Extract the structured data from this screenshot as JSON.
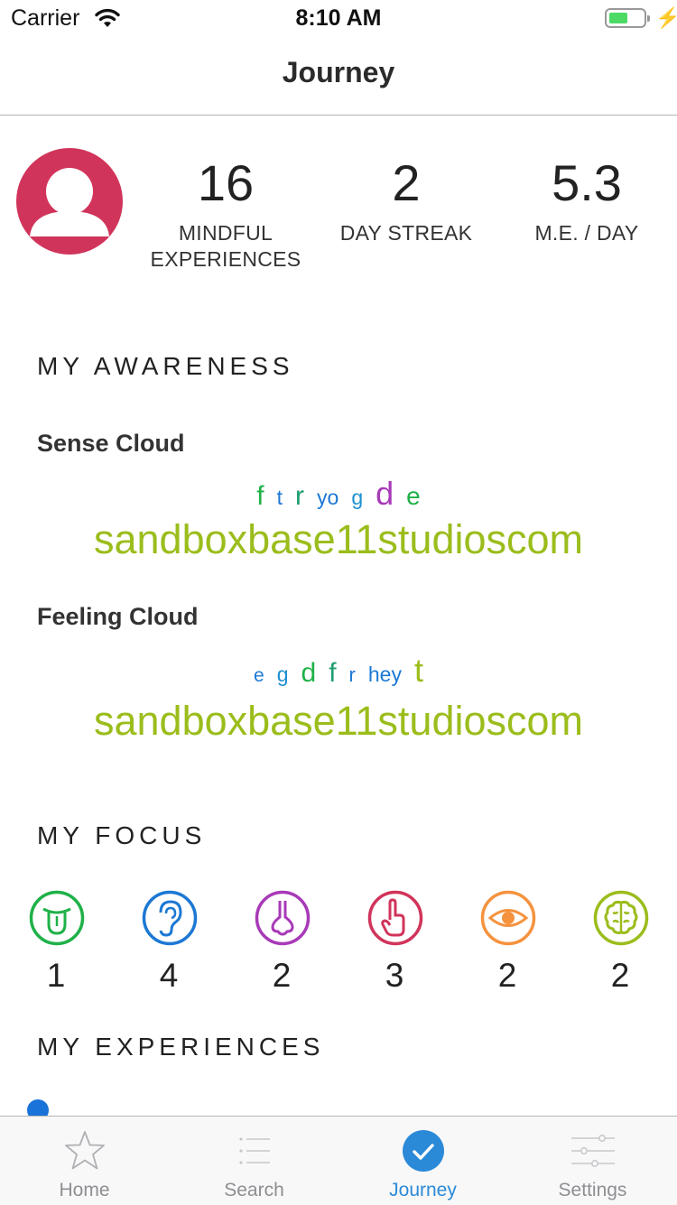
{
  "status_bar": {
    "carrier": "Carrier",
    "time": "8:10 AM"
  },
  "nav": {
    "title": "Journey"
  },
  "profile": {
    "stats": [
      {
        "value": "16",
        "label_line1": "MINDFUL",
        "label_line2": "EXPERIENCES"
      },
      {
        "value": "2",
        "label_line1": "DAY STREAK",
        "label_line2": ""
      },
      {
        "value": "5.3",
        "label_line1": "M.E. / DAY",
        "label_line2": ""
      }
    ]
  },
  "awareness": {
    "title": "MY AWARENESS",
    "sense_cloud": {
      "title": "Sense Cloud",
      "words": [
        {
          "text": "f",
          "color": "#1fb148"
        },
        {
          "text": "t",
          "color": "#1c78d4"
        },
        {
          "text": "r",
          "color": "#1c9e6e"
        },
        {
          "text": "yo",
          "color": "#1c78d4"
        },
        {
          "text": "g",
          "color": "#1c8fd0"
        },
        {
          "text": "d",
          "color": "#a83ab8"
        },
        {
          "text": "e",
          "color": "#1fb148"
        }
      ],
      "main_word": "sandboxbase11studioscom"
    },
    "feeling_cloud": {
      "title": "Feeling Cloud",
      "words": [
        {
          "text": "e",
          "color": "#1c78d4"
        },
        {
          "text": "g",
          "color": "#1c8fd0"
        },
        {
          "text": "d",
          "color": "#1fb148"
        },
        {
          "text": "f",
          "color": "#1c9e6e"
        },
        {
          "text": "r",
          "color": "#1c78d4"
        },
        {
          "text": "hey",
          "color": "#1c78d4"
        },
        {
          "text": "t",
          "color": "#9bbd1c"
        }
      ],
      "main_word": "sandboxbase11studioscom"
    }
  },
  "focus": {
    "title": "MY FOCUS",
    "items": [
      {
        "icon": "tongue-icon",
        "count": "1",
        "color": "#1fb148"
      },
      {
        "icon": "ear-icon",
        "count": "4",
        "color": "#1c78d4"
      },
      {
        "icon": "nose-icon",
        "count": "2",
        "color": "#a83ab8"
      },
      {
        "icon": "touch-hand-icon",
        "count": "3",
        "color": "#d1345b"
      },
      {
        "icon": "eye-icon",
        "count": "2",
        "color": "#f5923e"
      },
      {
        "icon": "brain-icon",
        "count": "2",
        "color": "#9bbd1c"
      }
    ]
  },
  "experiences": {
    "title": "MY EXPERIENCES"
  },
  "tabbar": {
    "tabs": [
      {
        "label": "Home",
        "icon": "star-icon"
      },
      {
        "label": "Search",
        "icon": "list-icon"
      },
      {
        "label": "Journey",
        "icon": "check-circle-icon"
      },
      {
        "label": "Settings",
        "icon": "sliders-icon"
      }
    ],
    "active_color": "#2b8ad8"
  }
}
